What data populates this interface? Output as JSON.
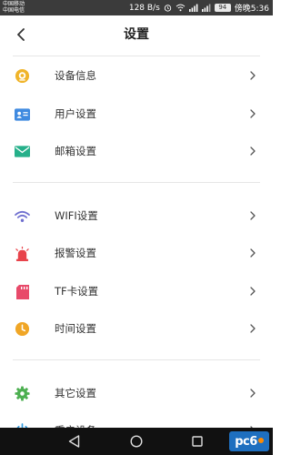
{
  "status_bar": {
    "carrier_1": "中国移动",
    "carrier_2": "中国电信",
    "speed": "128 B/s",
    "battery": "94",
    "time": "傍晚5:36"
  },
  "header": {
    "title": "设置"
  },
  "sections": [
    {
      "items": [
        {
          "label": "设备信息",
          "icon": "device-info-icon",
          "color": "#f0b429"
        },
        {
          "label": "用户设置",
          "icon": "user-card-icon",
          "color": "#3f8ae0"
        },
        {
          "label": "邮箱设置",
          "icon": "mail-icon",
          "color": "#26b08a"
        }
      ]
    },
    {
      "items": [
        {
          "label": "WIFI设置",
          "icon": "wifi-icon",
          "color": "#6f6fcf"
        },
        {
          "label": "报警设置",
          "icon": "alarm-icon",
          "color": "#e8434b"
        },
        {
          "label": "TF卡设置",
          "icon": "sd-card-icon",
          "color": "#e84a6a"
        },
        {
          "label": "时间设置",
          "icon": "clock-icon",
          "color": "#f0a626"
        }
      ]
    },
    {
      "items": [
        {
          "label": "其它设置",
          "icon": "gear-icon",
          "color": "#4caf50"
        },
        {
          "label": "重启设备",
          "icon": "power-icon",
          "color": "#2f9ae0"
        }
      ]
    }
  ],
  "watermark": {
    "text": "pc6"
  },
  "colors": {
    "status_bar_bg": "#3b3b3b",
    "nav_bar_bg": "#111111",
    "divider": "#e6e6e6",
    "chevron": "#555555",
    "watermark_bg": "#1e6fbf"
  }
}
